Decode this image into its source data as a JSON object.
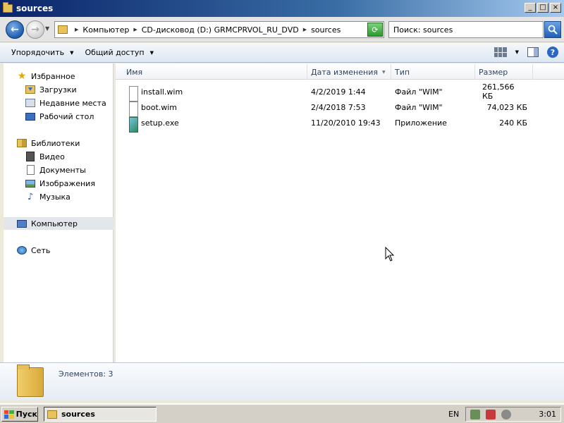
{
  "window": {
    "title": "sources"
  },
  "address": {
    "crumbs": [
      "Компьютер",
      "CD-дисковод (D:) GRMCPRVOL_RU_DVD",
      "sources"
    ],
    "search_placeholder": "Поиск: sources"
  },
  "toolbar": {
    "organize_label": "Упорядочить",
    "share_label": "Общий доступ"
  },
  "nav": {
    "favorites": {
      "label": "Избранное",
      "items": [
        "Загрузки",
        "Недавние места",
        "Рабочий стол"
      ]
    },
    "libraries": {
      "label": "Библиотеки",
      "items": [
        "Видео",
        "Документы",
        "Изображения",
        "Музыка"
      ]
    },
    "computer_label": "Компьютер",
    "network_label": "Сеть"
  },
  "columns": {
    "name": "Имя",
    "date": "Дата изменения",
    "type": "Тип",
    "size": "Размер"
  },
  "files": [
    {
      "name": "install.wim",
      "date": "4/2/2019 1:44",
      "type": "Файл \"WIM\"",
      "size": "261,566 КБ",
      "icon": "document-icon"
    },
    {
      "name": "boot.wim",
      "date": "2/4/2018 7:53",
      "type": "Файл \"WIM\"",
      "size": "74,023 КБ",
      "icon": "document-icon"
    },
    {
      "name": "setup.exe",
      "date": "11/20/2010 19:43",
      "type": "Приложение",
      "size": "240 КБ",
      "icon": "application-icon"
    }
  ],
  "details": {
    "item_count": "Элементов: 3"
  },
  "taskbar": {
    "start_label": "Пуск",
    "task_label": "sources",
    "language": "EN",
    "clock": "3:01"
  },
  "colors": {
    "titlebar_start": "#0a246a",
    "nav_selected": "#e3e6ea",
    "accent_blue": "#2a67c2"
  }
}
